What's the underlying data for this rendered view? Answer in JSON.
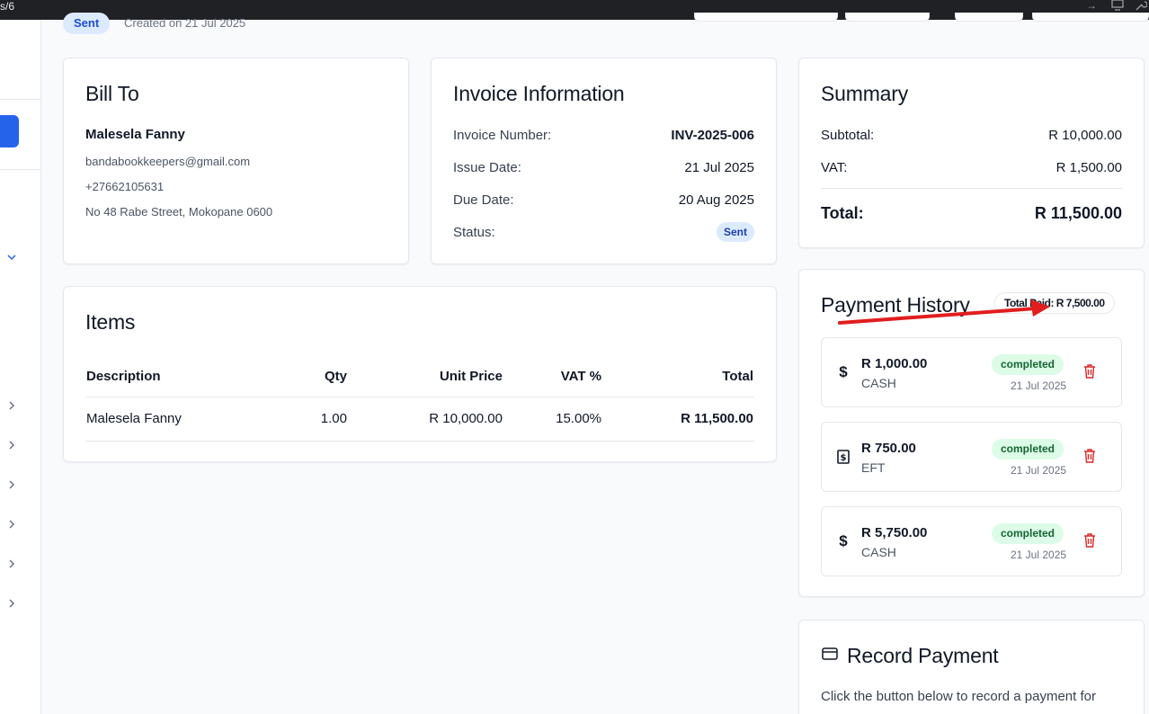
{
  "browser": {
    "url_fragment": "s/6"
  },
  "header": {
    "status_badge": "Sent",
    "created_text": "Created on 21 Jul 2025"
  },
  "bill_to": {
    "title": "Bill To",
    "name": "Malesela Fanny",
    "email": "bandabookkeepers@gmail.com",
    "phone": "+27662105631",
    "address": "No 48 Rabe Street, Mokopane 0600"
  },
  "invoice_info": {
    "title": "Invoice Information",
    "rows": [
      {
        "label": "Invoice Number:",
        "value": "INV-2025-006"
      },
      {
        "label": "Issue Date:",
        "value": "21 Jul 2025"
      },
      {
        "label": "Due Date:",
        "value": "20 Aug 2025"
      },
      {
        "label": "Status:",
        "value": "Sent"
      }
    ]
  },
  "summary": {
    "title": "Summary",
    "subtotal_label": "Subtotal:",
    "subtotal_value": "R 10,000.00",
    "vat_label": "VAT:",
    "vat_value": "R 1,500.00",
    "total_label": "Total:",
    "total_value": "R 11,500.00"
  },
  "items": {
    "title": "Items",
    "columns": [
      "Description",
      "Qty",
      "Unit Price",
      "VAT %",
      "Total"
    ],
    "rows": [
      {
        "description": "Malesela Fanny",
        "qty": "1.00",
        "unit_price": "R 10,000.00",
        "vat": "15.00%",
        "total": "R 11,500.00"
      }
    ]
  },
  "payment_history": {
    "title": "Payment History",
    "total_paid": "Total Paid: R 7,500.00",
    "payments": [
      {
        "icon": "dollar-icon",
        "amount": "R 1,000.00",
        "method": "CASH",
        "status": "completed",
        "date": "21 Jul 2025"
      },
      {
        "icon": "banknote-icon",
        "amount": "R 750.00",
        "method": "EFT",
        "status": "completed",
        "date": "21 Jul 2025"
      },
      {
        "icon": "dollar-icon",
        "amount": "R 5,750.00",
        "method": "CASH",
        "status": "completed",
        "date": "21 Jul 2025"
      }
    ]
  },
  "record_payment": {
    "title": "Record Payment",
    "description": "Click the button below to record a payment for"
  },
  "colors": {
    "accent": "#2563eb",
    "annotation_arrow": "#e11d1d",
    "delete": "#dc2626",
    "completed_bg": "#dcfce7"
  }
}
